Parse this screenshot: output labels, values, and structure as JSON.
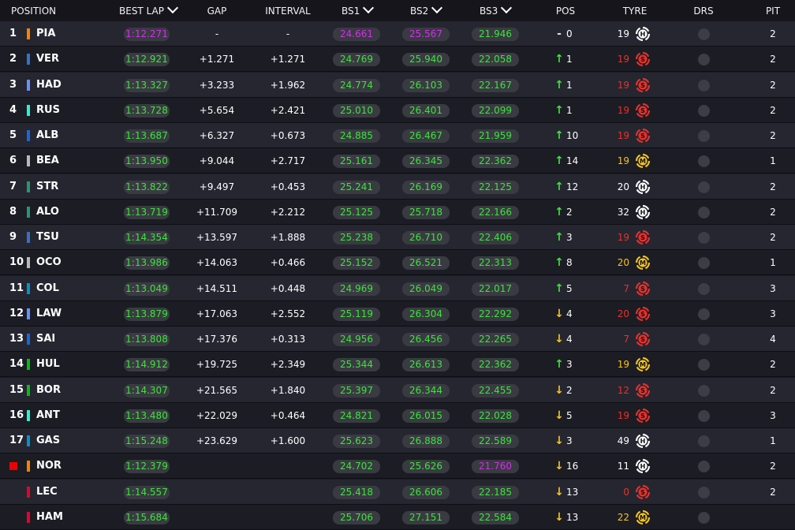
{
  "header": {
    "position": "POSITION",
    "best_lap": "BEST LAP",
    "gap": "GAP",
    "interval": "INTERVAL",
    "bs1": "BS1",
    "bs2": "BS2",
    "bs3": "BS3",
    "pos": "POS",
    "tyre": "TYRE",
    "drs": "DRS",
    "pit": "PIT"
  },
  "colors": {
    "soft": "#e8312b",
    "medium": "#f5c518",
    "hard": "#ffffff",
    "fastest": "#d62cf2",
    "personal_best": "#39e639"
  },
  "rows": [
    {
      "pos": "1",
      "code": "PIA",
      "team_color": "#ff8000",
      "best_lap": "1:12.271",
      "best_lap_color": "purple",
      "gap": "-",
      "interval": "-",
      "bs1": "24.661",
      "bs1_color": "purple",
      "bs2": "25.567",
      "bs2_color": "purple",
      "bs3": "21.946",
      "bs3_color": "green",
      "arrow": "-",
      "change": "0",
      "tyre_age": "19",
      "tyre": "H",
      "pit": "2"
    },
    {
      "pos": "2",
      "code": "VER",
      "team_color": "#3671c6",
      "best_lap": "1:12.921",
      "best_lap_color": "green",
      "gap": "+1.271",
      "interval": "+1.271",
      "bs1": "24.769",
      "bs1_color": "green",
      "bs2": "25.940",
      "bs2_color": "green",
      "bs3": "22.058",
      "bs3_color": "green",
      "arrow": "↑",
      "change": "1",
      "tyre_age": "19",
      "tyre": "S",
      "pit": "2"
    },
    {
      "pos": "3",
      "code": "HAD",
      "team_color": "#6692ff",
      "best_lap": "1:13.327",
      "best_lap_color": "green",
      "gap": "+3.233",
      "interval": "+1.962",
      "bs1": "24.774",
      "bs1_color": "green",
      "bs2": "26.103",
      "bs2_color": "green",
      "bs3": "22.167",
      "bs3_color": "green",
      "arrow": "↑",
      "change": "1",
      "tyre_age": "19",
      "tyre": "S",
      "pit": "2"
    },
    {
      "pos": "4",
      "code": "RUS",
      "team_color": "#27f4d2",
      "best_lap": "1:13.728",
      "best_lap_color": "green",
      "gap": "+5.654",
      "interval": "+2.421",
      "bs1": "25.010",
      "bs1_color": "green",
      "bs2": "26.401",
      "bs2_color": "green",
      "bs3": "22.099",
      "bs3_color": "green",
      "arrow": "↑",
      "change": "1",
      "tyre_age": "19",
      "tyre": "S",
      "pit": "2"
    },
    {
      "pos": "5",
      "code": "ALB",
      "team_color": "#1868db",
      "best_lap": "1:13.687",
      "best_lap_color": "green",
      "gap": "+6.327",
      "interval": "+0.673",
      "bs1": "24.885",
      "bs1_color": "green",
      "bs2": "26.467",
      "bs2_color": "green",
      "bs3": "21.959",
      "bs3_color": "green",
      "arrow": "↑",
      "change": "10",
      "tyre_age": "19",
      "tyre": "S",
      "pit": "2"
    },
    {
      "pos": "6",
      "code": "BEA",
      "team_color": "#b6babd",
      "best_lap": "1:13.950",
      "best_lap_color": "green",
      "gap": "+9.044",
      "interval": "+2.717",
      "bs1": "25.161",
      "bs1_color": "green",
      "bs2": "26.345",
      "bs2_color": "green",
      "bs3": "22.362",
      "bs3_color": "green",
      "arrow": "↑",
      "change": "14",
      "tyre_age": "19",
      "tyre": "M",
      "pit": "1"
    },
    {
      "pos": "7",
      "code": "STR",
      "team_color": "#229971",
      "best_lap": "1:13.822",
      "best_lap_color": "green",
      "gap": "+9.497",
      "interval": "+0.453",
      "bs1": "25.241",
      "bs1_color": "green",
      "bs2": "26.169",
      "bs2_color": "green",
      "bs3": "22.125",
      "bs3_color": "green",
      "arrow": "↑",
      "change": "12",
      "tyre_age": "20",
      "tyre": "H",
      "pit": "2"
    },
    {
      "pos": "8",
      "code": "ALO",
      "team_color": "#229971",
      "best_lap": "1:13.719",
      "best_lap_color": "green",
      "gap": "+11.709",
      "interval": "+2.212",
      "bs1": "25.125",
      "bs1_color": "green",
      "bs2": "25.718",
      "bs2_color": "green",
      "bs3": "22.166",
      "bs3_color": "green",
      "arrow": "↑",
      "change": "2",
      "tyre_age": "32",
      "tyre": "H",
      "pit": "2"
    },
    {
      "pos": "9",
      "code": "TSU",
      "team_color": "#3671c6",
      "best_lap": "1:14.354",
      "best_lap_color": "green",
      "gap": "+13.597",
      "interval": "+1.888",
      "bs1": "25.238",
      "bs1_color": "green",
      "bs2": "26.710",
      "bs2_color": "green",
      "bs3": "22.406",
      "bs3_color": "green",
      "arrow": "↑",
      "change": "3",
      "tyre_age": "19",
      "tyre": "S",
      "pit": "2"
    },
    {
      "pos": "10",
      "code": "OCO",
      "team_color": "#b6babd",
      "best_lap": "1:13.986",
      "best_lap_color": "green",
      "gap": "+14.063",
      "interval": "+0.466",
      "bs1": "25.152",
      "bs1_color": "green",
      "bs2": "26.521",
      "bs2_color": "green",
      "bs3": "22.313",
      "bs3_color": "green",
      "arrow": "↑",
      "change": "8",
      "tyre_age": "20",
      "tyre": "M",
      "pit": "1"
    },
    {
      "pos": "11",
      "code": "COL",
      "team_color": "#0093cc",
      "best_lap": "1:13.049",
      "best_lap_color": "green",
      "gap": "+14.511",
      "interval": "+0.448",
      "bs1": "24.969",
      "bs1_color": "green",
      "bs2": "26.049",
      "bs2_color": "green",
      "bs3": "22.017",
      "bs3_color": "green",
      "arrow": "↑",
      "change": "5",
      "tyre_age": "7",
      "tyre": "S",
      "pit": "3"
    },
    {
      "pos": "12",
      "code": "LAW",
      "team_color": "#6692ff",
      "best_lap": "1:13.879",
      "best_lap_color": "green",
      "gap": "+17.063",
      "interval": "+2.552",
      "bs1": "25.119",
      "bs1_color": "green",
      "bs2": "26.304",
      "bs2_color": "green",
      "bs3": "22.292",
      "bs3_color": "green",
      "arrow": "↓",
      "change": "4",
      "tyre_age": "20",
      "tyre": "S",
      "pit": "3"
    },
    {
      "pos": "13",
      "code": "SAI",
      "team_color": "#1868db",
      "best_lap": "1:13.808",
      "best_lap_color": "green",
      "gap": "+17.376",
      "interval": "+0.313",
      "bs1": "24.956",
      "bs1_color": "green",
      "bs2": "26.456",
      "bs2_color": "green",
      "bs3": "22.265",
      "bs3_color": "green",
      "arrow": "↓",
      "change": "4",
      "tyre_age": "7",
      "tyre": "S",
      "pit": "4"
    },
    {
      "pos": "14",
      "code": "HUL",
      "team_color": "#01c00e",
      "best_lap": "1:14.912",
      "best_lap_color": "green",
      "gap": "+19.725",
      "interval": "+2.349",
      "bs1": "25.344",
      "bs1_color": "green",
      "bs2": "26.613",
      "bs2_color": "green",
      "bs3": "22.362",
      "bs3_color": "green",
      "arrow": "↑",
      "change": "3",
      "tyre_age": "19",
      "tyre": "M",
      "pit": "2"
    },
    {
      "pos": "15",
      "code": "BOR",
      "team_color": "#01c00e",
      "best_lap": "1:14.307",
      "best_lap_color": "green",
      "gap": "+21.565",
      "interval": "+1.840",
      "bs1": "25.397",
      "bs1_color": "green",
      "bs2": "26.344",
      "bs2_color": "green",
      "bs3": "22.455",
      "bs3_color": "green",
      "arrow": "↓",
      "change": "2",
      "tyre_age": "12",
      "tyre": "S",
      "pit": "2"
    },
    {
      "pos": "16",
      "code": "ANT",
      "team_color": "#27f4d2",
      "best_lap": "1:13.480",
      "best_lap_color": "green",
      "gap": "+22.029",
      "interval": "+0.464",
      "bs1": "24.821",
      "bs1_color": "green",
      "bs2": "26.015",
      "bs2_color": "green",
      "bs3": "22.028",
      "bs3_color": "green",
      "arrow": "↓",
      "change": "5",
      "tyre_age": "19",
      "tyre": "S",
      "pit": "3"
    },
    {
      "pos": "17",
      "code": "GAS",
      "team_color": "#0093cc",
      "best_lap": "1:15.248",
      "best_lap_color": "green",
      "gap": "+23.629",
      "interval": "+1.600",
      "bs1": "25.623",
      "bs1_color": "green",
      "bs2": "26.888",
      "bs2_color": "green",
      "bs3": "22.589",
      "bs3_color": "green",
      "arrow": "↓",
      "change": "3",
      "tyre_age": "49",
      "tyre": "H",
      "pit": "1"
    },
    {
      "pos": "",
      "flag": "#e00000",
      "code": "NOR",
      "team_color": "#ff8000",
      "best_lap": "1:12.379",
      "best_lap_color": "green",
      "gap": "",
      "interval": "",
      "bs1": "24.702",
      "bs1_color": "green",
      "bs2": "25.626",
      "bs2_color": "green",
      "bs3": "21.760",
      "bs3_color": "purple",
      "arrow": "↓",
      "change": "16",
      "tyre_age": "11",
      "tyre": "H",
      "pit": "2"
    },
    {
      "pos": "",
      "code": "LEC",
      "team_color": "#e8002d",
      "best_lap": "1:14.557",
      "best_lap_color": "green",
      "gap": "",
      "interval": "",
      "bs1": "25.418",
      "bs1_color": "green",
      "bs2": "26.606",
      "bs2_color": "green",
      "bs3": "22.185",
      "bs3_color": "green",
      "arrow": "↓",
      "change": "13",
      "tyre_age": "0",
      "tyre": "S",
      "pit": "2"
    },
    {
      "pos": "",
      "code": "HAM",
      "team_color": "#e8002d",
      "best_lap": "1:15.684",
      "best_lap_color": "green",
      "gap": "",
      "interval": "",
      "bs1": "25.706",
      "bs1_color": "green",
      "bs2": "27.151",
      "bs2_color": "green",
      "bs3": "22.584",
      "bs3_color": "green",
      "arrow": "↓",
      "change": "13",
      "tyre_age": "22",
      "tyre": "M",
      "pit": ""
    }
  ]
}
